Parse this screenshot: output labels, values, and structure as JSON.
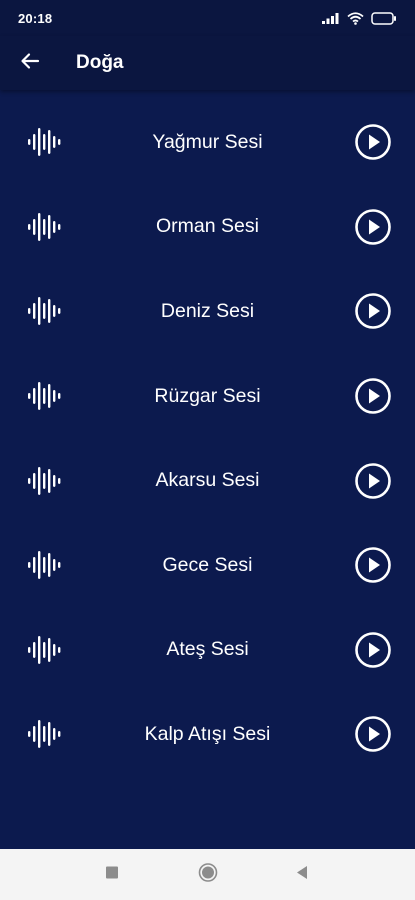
{
  "status_bar": {
    "time": "20:18",
    "icons": [
      "signal-icon",
      "wifi-icon",
      "battery-icon"
    ]
  },
  "app_bar": {
    "title": "Doğa",
    "back_icon": "arrow-left-icon"
  },
  "sounds": [
    {
      "label": "Yağmur Sesi"
    },
    {
      "label": "Orman Sesi"
    },
    {
      "label": "Deniz Sesi"
    },
    {
      "label": "Rüzgar Sesi"
    },
    {
      "label": "Akarsu Sesi"
    },
    {
      "label": "Gece Sesi"
    },
    {
      "label": "Ateş Sesi"
    },
    {
      "label": "Kalp Atışı Sesi"
    }
  ],
  "nav_bar": {
    "buttons": [
      "recents-square-icon",
      "home-circle-icon",
      "back-triangle-icon"
    ]
  },
  "colors": {
    "background": "#0c1a4e",
    "app_bar": "#0b1640",
    "foreground": "#ffffff",
    "nav_bar": "#f4f4f4"
  }
}
